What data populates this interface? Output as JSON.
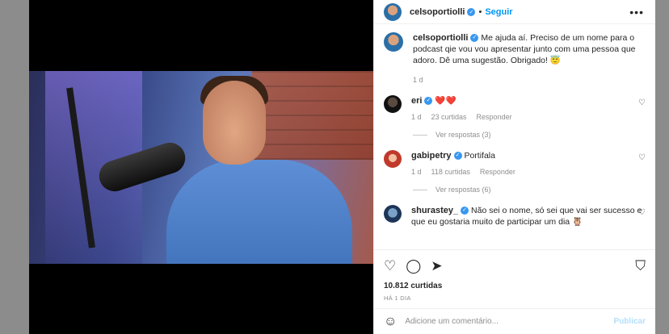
{
  "post": {
    "username": "celsoportiolli",
    "verified_mark": "✓",
    "follow_label": "Seguir",
    "separator": "•",
    "more_icon": "•••"
  },
  "caption": {
    "username": "celsoportiolli",
    "text": "Me ajuda aí. Preciso de um nome para o podcast qie vou vou apresentar junto com uma pessoa que adoro. Dê uma sugestão. Obrigado! 😇",
    "time": "1 d"
  },
  "comments": [
    {
      "username": "eri",
      "text": "❤️❤️",
      "time": "1 d",
      "likes": "23 curtidas",
      "reply": "Responder",
      "view_replies": "Ver respostas (3)"
    },
    {
      "username": "gabipetry",
      "text": "Portifala",
      "time": "1 d",
      "likes": "118 curtidas",
      "reply": "Responder",
      "view_replies": "Ver respostas (6)"
    },
    {
      "username": "shurastey_",
      "text": "Não sei o nome, só sei que vai ser sucesso e que eu gostaria muito de participar um dia 🦉"
    }
  ],
  "actions": {
    "like_icon": "♡",
    "comment_icon": "◯",
    "share_icon": "➤",
    "save_icon": "⛉"
  },
  "likes_count": "10.812 curtidas",
  "posted_ago": "HÁ 1 DIA",
  "add_comment": {
    "emoji_icon": "☺",
    "placeholder": "Adicione um comentário...",
    "publish_label": "Publicar"
  },
  "colors": {
    "accent": "#0095f6",
    "verified": "#3897f0",
    "publish_disabled": "#b2dffc"
  }
}
